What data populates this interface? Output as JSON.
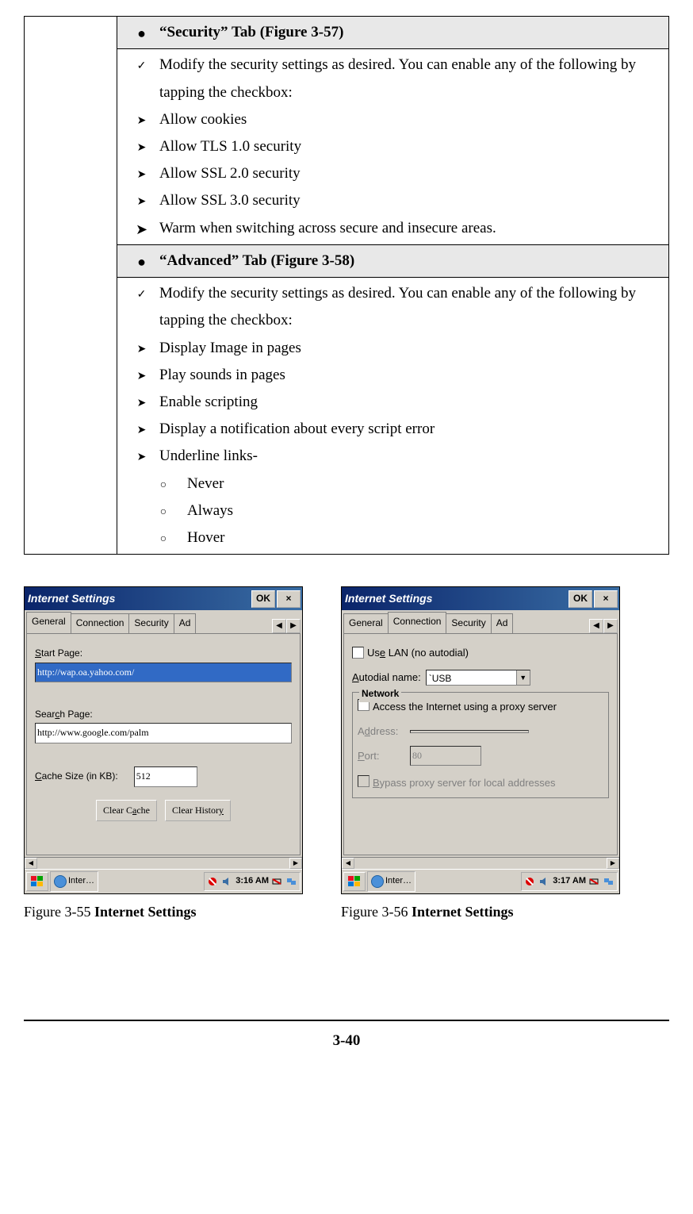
{
  "table": {
    "sec_header": "“Security” Tab (Figure 3-57)",
    "sec_intro": "Modify the security settings as desired. You can enable any of the following by tapping the checkbox:",
    "sec_items": [
      "Allow cookies",
      "Allow TLS 1.0 security",
      "Allow SSL 2.0 security",
      "Allow SSL 3.0 security"
    ],
    "sec_last": "Warm when switching across secure and insecure areas.",
    "adv_header": "“Advanced” Tab (Figure 3-58)",
    "adv_intro": "Modify the security settings as desired. You can enable any of the following by tapping the checkbox:",
    "adv_items": [
      "Display Image in pages",
      "Play sounds in pages",
      "Enable scripting",
      "Display a notification about every script error",
      "Underline links-"
    ],
    "adv_sub": [
      "Never",
      "Always",
      "Hover"
    ]
  },
  "ss1": {
    "title": "Internet Settings",
    "ok": "OK",
    "close": "×",
    "tabs": [
      "General",
      "Connection",
      "Security",
      "Ad"
    ],
    "startpage_label": "Start Page:",
    "startpage_value": "http://wap.oa.yahoo.com/",
    "searchpage_label": "Search Page:",
    "searchpage_value": "http://www.google.com/palm",
    "cache_label": "Cache Size (in KB):",
    "cache_value": "512",
    "clearcache": "Clear Cache",
    "clearhistory": "Clear History",
    "task": "Inter…",
    "time": "3:16 AM"
  },
  "ss2": {
    "title": "Internet Settings",
    "ok": "OK",
    "close": "×",
    "tabs": [
      "General",
      "Connection",
      "Security",
      "Ad"
    ],
    "uselan": "Use LAN (no autodial)",
    "autodial_label": "Autodial name:",
    "autodial_value": "`USB",
    "group_title": "Network",
    "proxy_text": "Access the Internet using a proxy server",
    "address_label": "Address:",
    "port_label": "Port:",
    "port_value": "80",
    "bypass": "Bypass proxy server for local addresses",
    "task": "Inter…",
    "time": "3:17 AM"
  },
  "captions": {
    "c1_prefix": "Figure 3-55 ",
    "c1_bold": "Internet Settings",
    "c2_prefix": "Figure 3-56 ",
    "c2_bold": "Internet Settings"
  },
  "page_number": "3-40"
}
